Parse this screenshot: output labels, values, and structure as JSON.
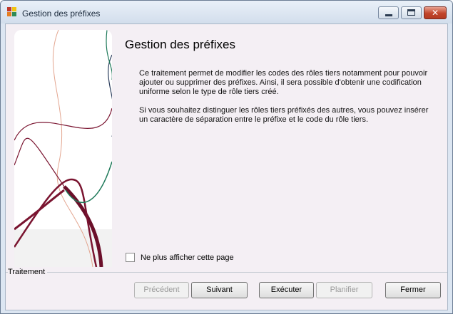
{
  "window": {
    "title": "Gestion des préfixes"
  },
  "colors": {
    "app_icon": [
      "#c0392b",
      "#e67e22",
      "#2e8b57",
      "#f1c40f"
    ],
    "panel_curve_dark": "#7a1430",
    "panel_curve_green": "#1f7a5a",
    "panel_curve_light": "#e3a58f"
  },
  "main": {
    "heading": "Gestion des préfixes",
    "paragraph1": "Ce traitement permet de modifier les codes des rôles tiers notamment pour pouvoir ajouter ou supprimer des préfixes. Ainsi, il sera possible d'obtenir une codification uniforme selon le type de rôle tiers créé.",
    "paragraph2": "Si vous souhaitez distinguer les rôles tiers préfixés des autres, vous pouvez insérer un caractère de séparation entre le préfixe et le code du rôle tiers."
  },
  "options": {
    "dont_show_label": "Ne plus afficher cette page",
    "dont_show_checked": false
  },
  "footer": {
    "group_label": "Traitement",
    "buttons": {
      "previous": "Précédent",
      "next": "Suivant",
      "execute": "Exécuter",
      "schedule": "Planifier",
      "close": "Fermer"
    }
  }
}
